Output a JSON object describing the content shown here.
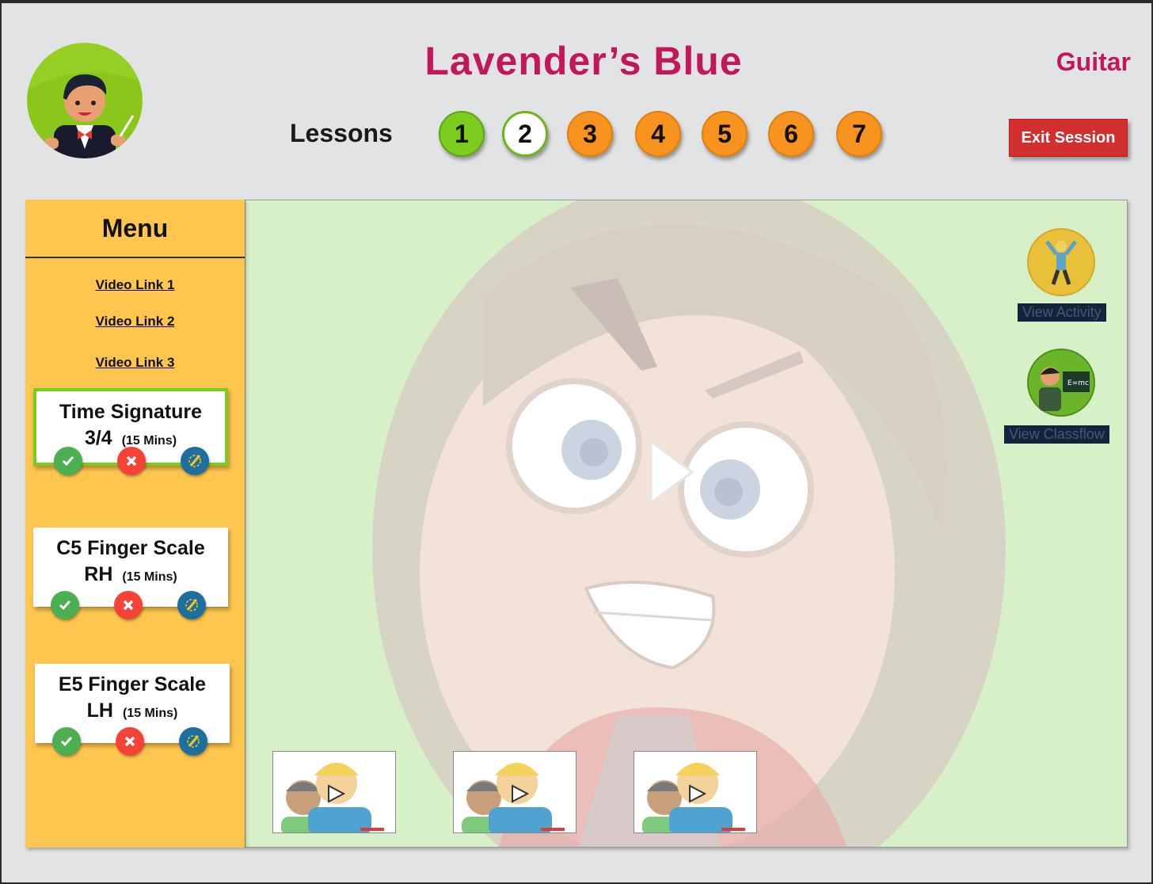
{
  "header": {
    "title": "Lavender’s Blue",
    "instrument": "Guitar",
    "lessons_label": "Lessons",
    "lessons": [
      {
        "label": "1",
        "state": "done"
      },
      {
        "label": "2",
        "state": "current"
      },
      {
        "label": "3",
        "state": "todo"
      },
      {
        "label": "4",
        "state": "todo"
      },
      {
        "label": "5",
        "state": "todo"
      },
      {
        "label": "6",
        "state": "todo"
      },
      {
        "label": "7",
        "state": "todo"
      }
    ],
    "exit_label": "Exit Session"
  },
  "menu": {
    "title": "Menu",
    "video_links": [
      "Video Link 1",
      "Video Link 2",
      "Video Link 3"
    ],
    "activities": [
      {
        "line1": "Time Signature",
        "line2": "3/4",
        "duration": "(15 Mins)",
        "active": true
      },
      {
        "line1": "C5 Finger Scale",
        "line2": "RH",
        "duration": "(15 Mins)",
        "active": false
      },
      {
        "line1": "E5 Finger Scale",
        "line2": "LH",
        "duration": "(15 Mins)",
        "active": false
      }
    ]
  },
  "side_actions": {
    "view_activity": "View Activity",
    "view_classflow": "View Classflow"
  },
  "colors": {
    "accent": "#c2185b",
    "menu_bg": "#ffc64f",
    "done": "#7ccb1f",
    "todo": "#f7931e",
    "exit": "#d32f2f",
    "video_bg": "#d8f0c8"
  }
}
